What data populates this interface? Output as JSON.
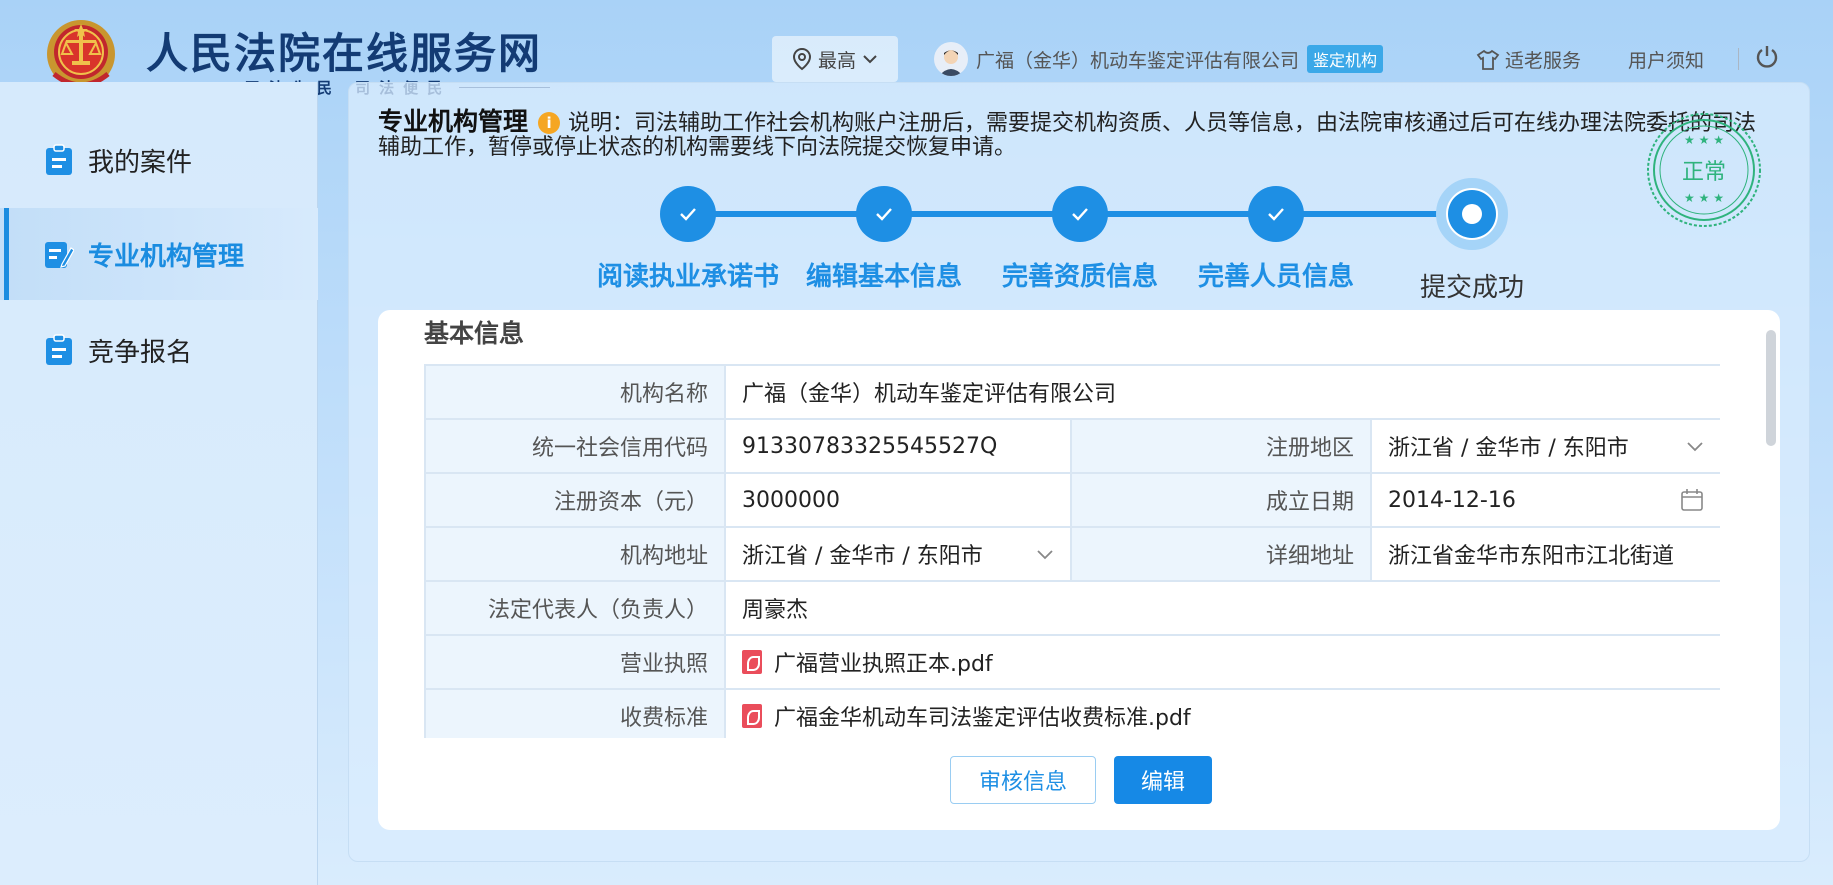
{
  "header": {
    "site_title": "人民法院在线服务网",
    "slogan": "司法为民 司法便民",
    "level_label": "最高",
    "user_name": "广福（金华）机动车鉴定评估有限公司",
    "user_badge": "鉴定机构",
    "elder_service": "适老服务",
    "user_notice": "用户须知"
  },
  "sidebar": {
    "items": [
      {
        "label": "我的案件",
        "active": false
      },
      {
        "label": "专业机构管理",
        "active": true
      },
      {
        "label": "竞争报名",
        "active": false
      }
    ]
  },
  "notice": {
    "title": "专业机构管理",
    "text": "说明：司法辅助工作社会机构账户注册后，需要提交机构资质、人员等信息，由法院审核通过后可在线办理法院委托的司法辅助工作，暂停或停止状态的机构需要线下向法院提交恢复申请。"
  },
  "stamp": {
    "text": "正常",
    "color": "#2fb37d"
  },
  "steps": [
    {
      "label": "阅读执业承诺书",
      "status": "done"
    },
    {
      "label": "编辑基本信息",
      "status": "done"
    },
    {
      "label": "完善资质信息",
      "status": "done"
    },
    {
      "label": "完善人员信息",
      "status": "done"
    },
    {
      "label": "提交成功",
      "status": "current"
    }
  ],
  "card": {
    "title": "基本信息",
    "fields": {
      "org_name_label": "机构名称",
      "org_name": "广福（金华）机动车鉴定评估有限公司",
      "credit_code_label": "统一社会信用代码",
      "credit_code": "91330783325545527Q",
      "region_label": "注册地区",
      "region": "浙江省 / 金华市 / 东阳市",
      "capital_label": "注册资本（元）",
      "capital": "3000000",
      "found_date_label": "成立日期",
      "found_date": "2014-12-16",
      "address_label": "机构地址",
      "address": "浙江省 / 金华市 / 东阳市",
      "detail_address_label": "详细地址",
      "detail_address": "浙江省金华市东阳市江北街道",
      "legal_rep_label": "法定代表人（负责人）",
      "legal_rep": "周豪杰",
      "license_label": "营业执照",
      "license_file": "广福营业执照正本.pdf",
      "fee_label": "收费标准",
      "fee_file": "广福金华机动车司法鉴定评估收费标准.pdf"
    },
    "buttons": {
      "review": "审核信息",
      "edit": "编辑"
    }
  },
  "colors": {
    "primary": "#1e8fe4",
    "title_navy": "#133b74",
    "stamp_green": "#2fb37d"
  }
}
